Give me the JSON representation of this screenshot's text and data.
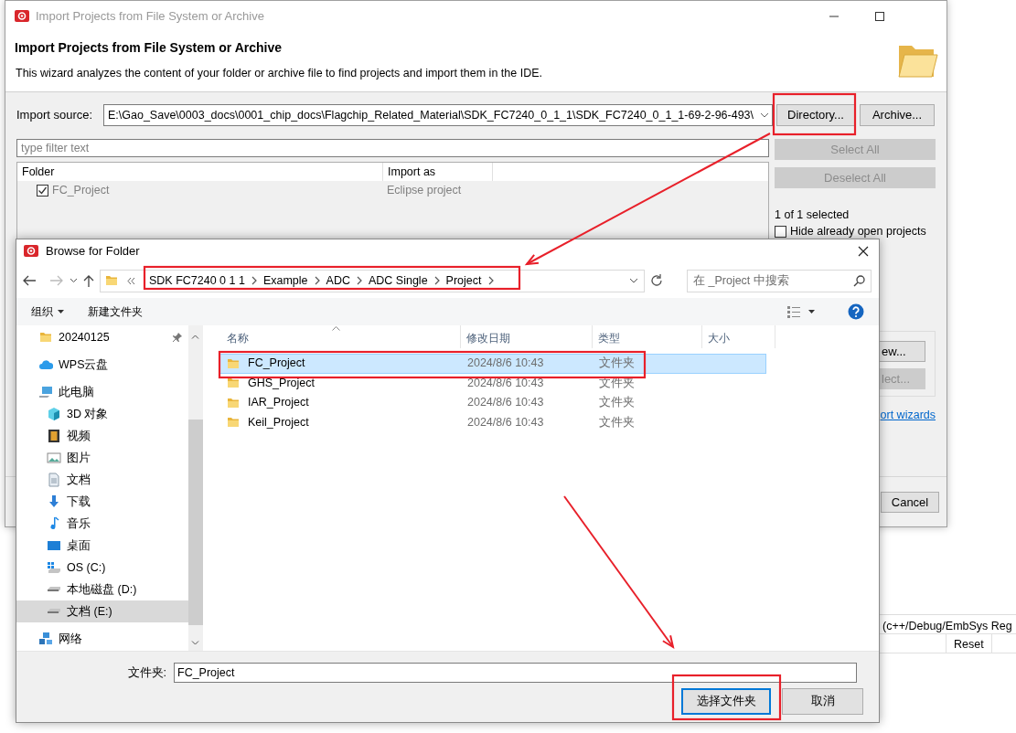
{
  "wizard": {
    "title": "Import Projects from File System or Archive",
    "heading": "Import Projects from File System or Archive",
    "description": "This wizard analyzes the content of your folder or archive file to find projects and import them in the IDE.",
    "import_source": {
      "label": "Import source:",
      "value": "E:\\Gao_Save\\0003_docs\\0001_chip_docs\\Flagchip_Related_Material\\SDK_FC7240_0_1_1\\SDK_FC7240_0_1_1-69-2-96-493\\"
    },
    "source_buttons": [
      {
        "label": "Directory...",
        "disabled": false
      },
      {
        "label": "Archive...",
        "disabled": false
      }
    ],
    "filter": {
      "placeholder": "type filter text"
    },
    "table": {
      "columns": [
        "Folder",
        "Import as"
      ],
      "rows": [
        {
          "folder": "FC_Project",
          "import_as": "Eclipse project",
          "checked": true
        }
      ]
    },
    "selection_buttons": [
      {
        "label": "Select All",
        "disabled": true
      },
      {
        "label": "Deselect All",
        "disabled": true
      }
    ],
    "selection_count": "1 of 1 selected",
    "hide_open_projects": {
      "label": "Hide already open projects",
      "checked": false
    },
    "group_buttons": [
      {
        "label": "ew...",
        "disabled": false
      },
      {
        "label": "lect...",
        "disabled": true
      }
    ],
    "link": "ort wizards",
    "cancel_button": "Cancel"
  },
  "browse_dialog": {
    "title": "Browse for Folder",
    "breadcrumb": [
      "SDK FC7240 0 1 1",
      "Example",
      "ADC",
      "ADC Single",
      "Project"
    ],
    "search": {
      "placeholder": "在 _Project 中搜索"
    },
    "toolbar": [
      {
        "label": "组织",
        "dropdown": true
      },
      {
        "label": "新建文件夹",
        "dropdown": false
      }
    ],
    "navigation": [
      {
        "label": "20240125",
        "kind": "folder",
        "pinned": true,
        "selected": false
      },
      {
        "label": "WPS云盘",
        "kind": "cloud",
        "pinned": false,
        "selected": false
      },
      {
        "label": "此电脑",
        "kind": "computer",
        "pinned": false,
        "selected": false,
        "children": [
          {
            "label": "3D 对象",
            "kind": "cube",
            "pinned": false,
            "selected": false
          },
          {
            "label": "视频",
            "kind": "video",
            "pinned": false,
            "selected": false
          },
          {
            "label": "图片",
            "kind": "image",
            "pinned": false,
            "selected": false
          },
          {
            "label": "文档",
            "kind": "document",
            "pinned": false,
            "selected": false
          },
          {
            "label": "下载",
            "kind": "download",
            "pinned": false,
            "selected": false
          },
          {
            "label": "音乐",
            "kind": "music",
            "pinned": false,
            "selected": false
          },
          {
            "label": "桌面",
            "kind": "desktop",
            "pinned": false,
            "selected": false
          },
          {
            "label": "OS (C:)",
            "kind": "system",
            "pinned": false,
            "selected": false
          },
          {
            "label": "本地磁盘 (D:)",
            "kind": "drive",
            "pinned": false,
            "selected": false
          },
          {
            "label": "文档 (E:)",
            "kind": "drive",
            "pinned": false,
            "selected": true
          }
        ]
      },
      {
        "label": "网络",
        "kind": "network",
        "pinned": false,
        "selected": false
      }
    ],
    "columns": [
      "名称",
      "修改日期",
      "类型",
      "大小"
    ],
    "files": [
      {
        "name": "FC_Project",
        "modified": "2024/8/6 10:43",
        "type": "文件夹",
        "selected": true
      },
      {
        "name": "GHS_Project",
        "modified": "2024/8/6 10:43",
        "type": "文件夹",
        "selected": false
      },
      {
        "name": "IAR_Project",
        "modified": "2024/8/6 10:43",
        "type": "文件夹",
        "selected": false
      },
      {
        "name": "Keil_Project",
        "modified": "2024/8/6 10:43",
        "type": "文件夹",
        "selected": false
      }
    ],
    "folder_field": {
      "label": "文件夹:",
      "value": "FC_Project"
    },
    "buttons": [
      {
        "label": "选择文件夹",
        "default": true
      },
      {
        "label": "取消",
        "default": false
      }
    ]
  },
  "background_panel": {
    "title": "(c++/Debug/EmbSys Reg",
    "columns": [
      "Reset"
    ]
  }
}
